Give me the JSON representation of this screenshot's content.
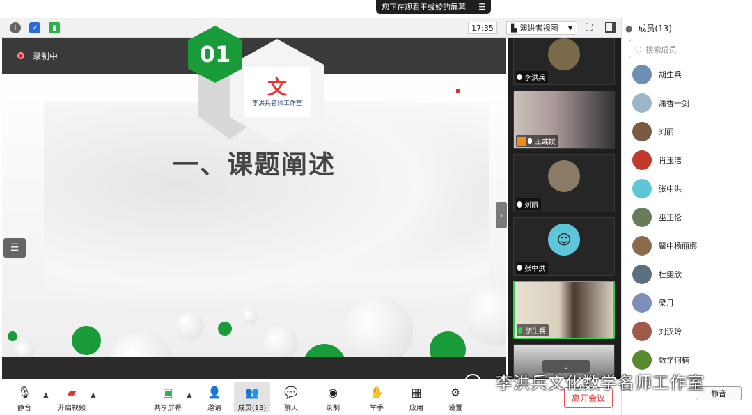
{
  "banner": {
    "text": "您正在观看王彧姣的屏幕",
    "menu_icon": "menu-icon"
  },
  "topbar": {
    "time": "17:35",
    "view_mode": "演讲者视图"
  },
  "share": {
    "recording": "录制中",
    "slide": {
      "number": "01",
      "logo_char": "文",
      "logo_text": "李洪兵名师工作室",
      "title": "一、课题阐述"
    }
  },
  "gallery": [
    {
      "name": "李洪兵",
      "color": "#7a6a4a"
    },
    {
      "name": "王彧姣",
      "color": "#6b5a48"
    },
    {
      "name": "刘丽",
      "color": "#8a7a66"
    },
    {
      "name": "张中洪",
      "color": "#5ec6d8"
    },
    {
      "name": "胡生兵",
      "color": "#a08060"
    }
  ],
  "panel": {
    "title": "成员(13)",
    "search_placeholder": "搜索成员",
    "members": [
      {
        "name": "胡生兵",
        "color": "#6d8fb3"
      },
      {
        "name": "潇香一剑",
        "color": "#9db5c8"
      },
      {
        "name": "刘丽",
        "color": "#7a5a40"
      },
      {
        "name": "肖玉洁",
        "color": "#c0392b"
      },
      {
        "name": "张中洪",
        "color": "#5ec6d8"
      },
      {
        "name": "巫正伦",
        "color": "#6a7a5a"
      },
      {
        "name": "鳘中杨丽娜",
        "color": "#8b6b4a"
      },
      {
        "name": "杜雯欣",
        "color": "#5a7080"
      },
      {
        "name": "梁月",
        "color": "#7d8fb8"
      },
      {
        "name": "刘汉玲",
        "color": "#a05a4a"
      },
      {
        "name": "数学何楠",
        "color": "#5a8a30"
      }
    ],
    "mute_all": "静音"
  },
  "toolbar": {
    "mute": "静音",
    "video": "开启视频",
    "share_screen": "共享屏幕",
    "invite": "邀请",
    "members": "成员(13)",
    "chat": "聊天",
    "record": "录制",
    "raise_hand": "举手",
    "apps": "应用",
    "settings": "设置",
    "leave": "离开会议"
  },
  "watermark": "李洪兵文化数学名师工作室"
}
